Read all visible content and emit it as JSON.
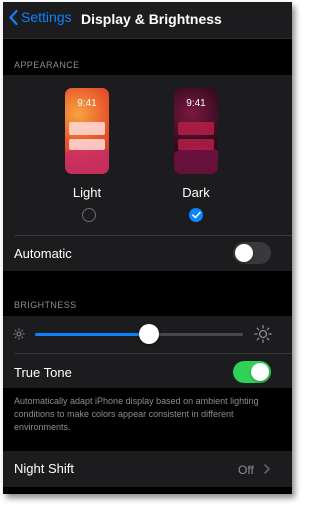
{
  "nav": {
    "back_label": "Settings",
    "title": "Display & Brightness"
  },
  "appearance": {
    "header": "APPEARANCE",
    "preview_time": "9:41",
    "light_label": "Light",
    "dark_label": "Dark",
    "selected": "Dark",
    "automatic_label": "Automatic",
    "automatic_on": false
  },
  "brightness": {
    "header": "BRIGHTNESS",
    "level": 0.55,
    "true_tone_label": "True Tone",
    "true_tone_on": true,
    "footnote": "Automatically adapt iPhone display based on ambient lighting conditions to make colors appear consistent in different environments."
  },
  "night_shift": {
    "label": "Night Shift",
    "value": "Off"
  },
  "colors": {
    "accent": "#0a84ff",
    "toggle_on": "#30d158",
    "toggle_off": "#39393d",
    "background": "#000000",
    "cell": "#1c1c1e",
    "secondary_text": "#8e8e93"
  }
}
